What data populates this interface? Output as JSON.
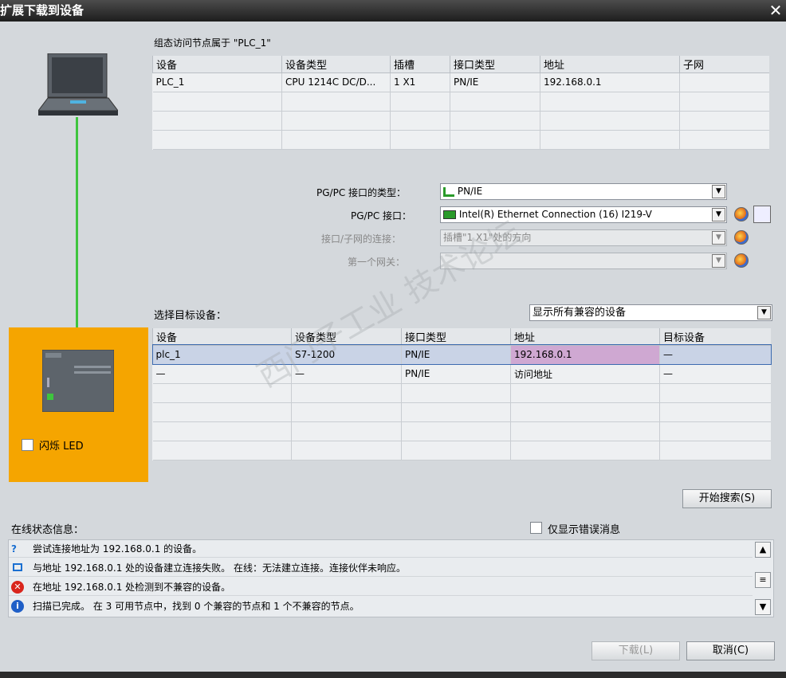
{
  "window": {
    "title": "扩展下载到设备",
    "close_glyph": "✕"
  },
  "config_header": "组态访问节点属于 \"PLC_1\"",
  "config_table": {
    "columns": [
      "设备",
      "设备类型",
      "插槽",
      "接口类型",
      "地址",
      "子网"
    ],
    "rows": [
      [
        "PLC_1",
        "CPU 1214C DC/D...",
        "1 X1",
        "PN/IE",
        "192.168.0.1",
        ""
      ]
    ]
  },
  "interface": {
    "type_label": "PG/PC 接口的类型：",
    "type_value": "PN/IE",
    "pgpc_label": "PG/PC 接口：",
    "pgpc_value": "Intel(R) Ethernet Connection (16) I219-V",
    "subnet_label": "接口/子网的连接：",
    "subnet_value": "插槽\"1 X1\"处的方向",
    "gateway_label": "第一个网关：",
    "gateway_value": ""
  },
  "target": {
    "label": "选择目标设备：",
    "filter_value": "显示所有兼容的设备",
    "columns": [
      "设备",
      "设备类型",
      "接口类型",
      "地址",
      "目标设备"
    ],
    "rows": [
      [
        "plc_1",
        "S7-1200",
        "PN/IE",
        "192.168.0.1",
        "—"
      ],
      [
        "—",
        "—",
        "PN/IE",
        "访问地址",
        "—"
      ]
    ]
  },
  "flash_led_label": "闪烁 LED",
  "search_button": "开始搜索(S)",
  "status": {
    "label": "在线状态信息：",
    "only_errors_label": "仅显示错误消息",
    "messages": [
      {
        "icon": "connect-question-icon",
        "text": "尝试连接地址为 192.168.0.1 的设备。"
      },
      {
        "icon": "connect-fail-icon",
        "text": "与地址 192.168.0.1 处的设备建立连接失败。 在线：无法建立连接。连接伙伴未响应。"
      },
      {
        "icon": "error-icon",
        "text": "在地址 192.168.0.1 处检测到不兼容的设备。"
      },
      {
        "icon": "info-icon",
        "text": "扫描已完成。 在 3 可用节点中，找到 0 个兼容的节点和 1 个不兼容的节点。"
      }
    ]
  },
  "buttons": {
    "download": "下载(L)",
    "cancel": "取消(C)"
  },
  "colors": {
    "accent_orange": "#f5a500",
    "link_green": "#3ec43e",
    "selected_addr": "#cfa8d2"
  }
}
